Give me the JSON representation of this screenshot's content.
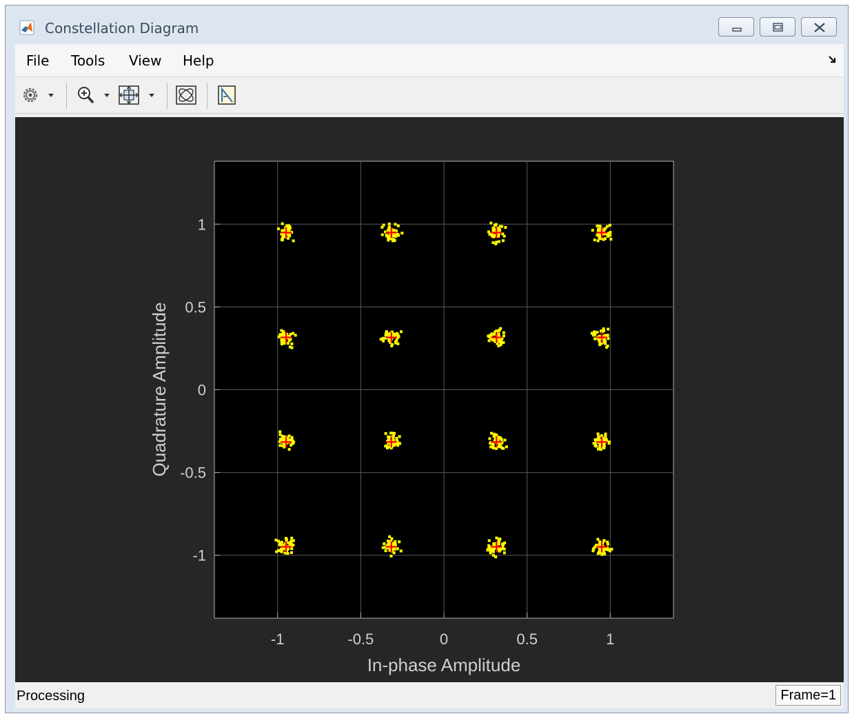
{
  "window": {
    "title": "Constellation Diagram",
    "icons": {
      "app": "matlab-icon",
      "minimize": "minimize-icon",
      "restore": "restore-icon",
      "close": "close-icon"
    }
  },
  "menu": {
    "file": "File",
    "tools": "Tools",
    "view": "View",
    "help": "Help",
    "dock_icon": "dock-arrow-icon"
  },
  "toolbar": {
    "icons": [
      "gear-icon",
      "dropdown-arrow-icon",
      "zoom-in-icon",
      "dropdown-arrow-icon",
      "fit-to-view-icon",
      "dropdown-arrow-icon",
      "reference-constellation-icon",
      "measurements-icon"
    ]
  },
  "colors": {
    "panel_background": "#262626",
    "axes_background": "#000000",
    "grid": "#5a5a5a",
    "tick_text": "#d0d0d0",
    "samples": "#ffff00",
    "reference": "#ff0000"
  },
  "chart_data": {
    "type": "scatter",
    "title": "",
    "xlabel": "In-phase Amplitude",
    "ylabel": "Quadrature Amplitude",
    "xlim": [
      -1.38,
      1.38
    ],
    "ylim": [
      -1.38,
      1.38
    ],
    "xticks": [
      -1,
      -0.5,
      0,
      0.5,
      1
    ],
    "xtick_labels": [
      "-1",
      "-0.5",
      "0",
      "0.5",
      "1"
    ],
    "yticks": [
      -1,
      -0.5,
      0,
      0.5,
      1
    ],
    "ytick_labels": [
      "-1",
      "-0.5",
      "0",
      "0.5",
      "1"
    ],
    "grid": true,
    "legend": "none",
    "reference_points": {
      "x": [
        -0.949,
        -0.316,
        0.316,
        0.949,
        -0.949,
        -0.316,
        0.316,
        0.949,
        -0.949,
        -0.316,
        0.316,
        0.949,
        -0.949,
        -0.316,
        0.316,
        0.949
      ],
      "y": [
        0.949,
        0.949,
        0.949,
        0.949,
        0.316,
        0.316,
        0.316,
        0.316,
        -0.316,
        -0.316,
        -0.316,
        -0.316,
        -0.949,
        -0.949,
        -0.949,
        -0.949
      ]
    },
    "sample_spread": 0.03
  },
  "status": {
    "text": "Processing",
    "frame": "Frame=1"
  }
}
